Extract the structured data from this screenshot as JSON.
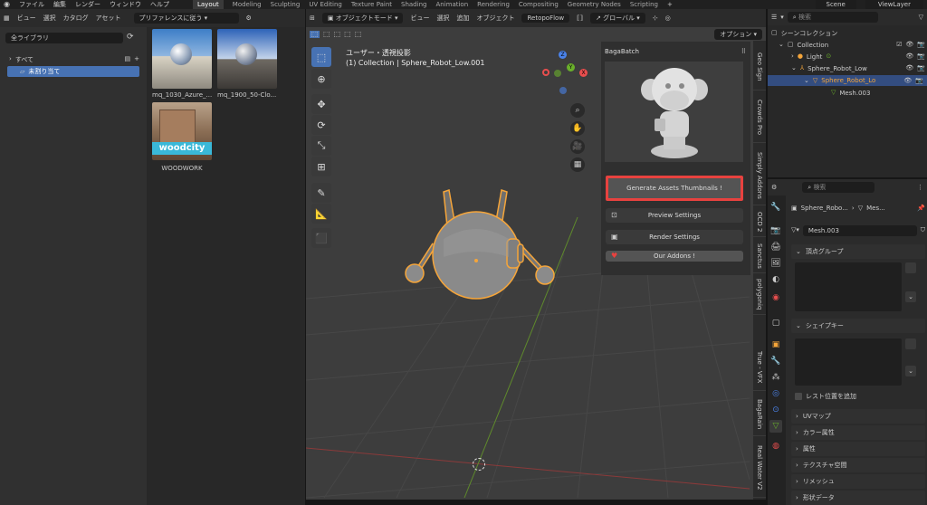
{
  "topbar": {
    "menu": [
      "ファイル",
      "編集",
      "レンダー",
      "ウィンドウ",
      "ヘルプ"
    ],
    "workspaces": [
      "Layout",
      "Modeling",
      "Sculpting",
      "UV Editing",
      "Texture Paint",
      "Shading",
      "Animation",
      "Rendering",
      "Compositing",
      "Geometry Nodes",
      "Scripting"
    ],
    "add": "+",
    "scene": "Scene",
    "view_layer": "ViewLayer"
  },
  "asset_browser": {
    "menu": [
      "ビュー",
      "選択",
      "カタログ",
      "アセット"
    ],
    "import_method": "プリファレンスに従う",
    "library": "全ライブラリ",
    "tree": {
      "all": "すべて",
      "unassigned": "未割り当て"
    },
    "assets": [
      {
        "name": "mq_1030_Azure_..."
      },
      {
        "name": "mq_1900_50-Clo..."
      },
      {
        "name": "WOODWORK",
        "overlay": "woodcity"
      }
    ]
  },
  "viewport": {
    "mode": "オブジェクトモード",
    "menu": [
      "ビュー",
      "選択",
      "追加",
      "オブジェクト"
    ],
    "addon_menu": "RetopoFlow",
    "transform_orientation": "グローバル",
    "options": "オプション",
    "view_label": "ユーザー・透視投影",
    "collection_label": "(1) Collection | Sphere_Robot_Low.001"
  },
  "gizmo": {
    "z": "Z",
    "y": "Y",
    "x": "X"
  },
  "sidebar": {
    "panel_title": "BagaBatch",
    "generate_btn": "Generate Assets Thumbnails !",
    "preview_btn": "Preview Settings",
    "render_btn": "Render Settings",
    "addons_btn": "Our Addons !",
    "tabs": [
      "Geo Sign",
      "Crowds Pro",
      "Simply Addons",
      "OCD 2",
      "Sanctus",
      "polygoniq",
      "True - VFX",
      "BagaRain",
      "Real Water V2"
    ]
  },
  "outliner": {
    "search_placeholder": "検索",
    "scene_collection": "シーンコレクション",
    "items": [
      {
        "label": "Collection"
      },
      {
        "label": "Light"
      },
      {
        "label": "Sphere_Robot_Low"
      },
      {
        "label": "Sphere_Robot_Lo"
      },
      {
        "label": "Mesh.003"
      }
    ]
  },
  "properties": {
    "search_placeholder": "検索",
    "breadcrumb": [
      "Sphere_Robo...",
      "Mes..."
    ],
    "mesh_name": "Mesh.003",
    "vertex_groups": "頂点グループ",
    "shape_keys": "シェイプキー",
    "relative": "レスト位置を追加",
    "sections": [
      "UVマップ",
      "カラー属性",
      "属性",
      "テクスチャ空間",
      "リメッシュ",
      "形状データ"
    ]
  },
  "colors": {
    "accent": "#4772b3",
    "highlight": "#e8423f",
    "selection": "#f5a53a",
    "gizmo_x": "#e84e4e",
    "gizmo_y": "#6ab02b",
    "gizmo_z": "#4a82e8"
  }
}
